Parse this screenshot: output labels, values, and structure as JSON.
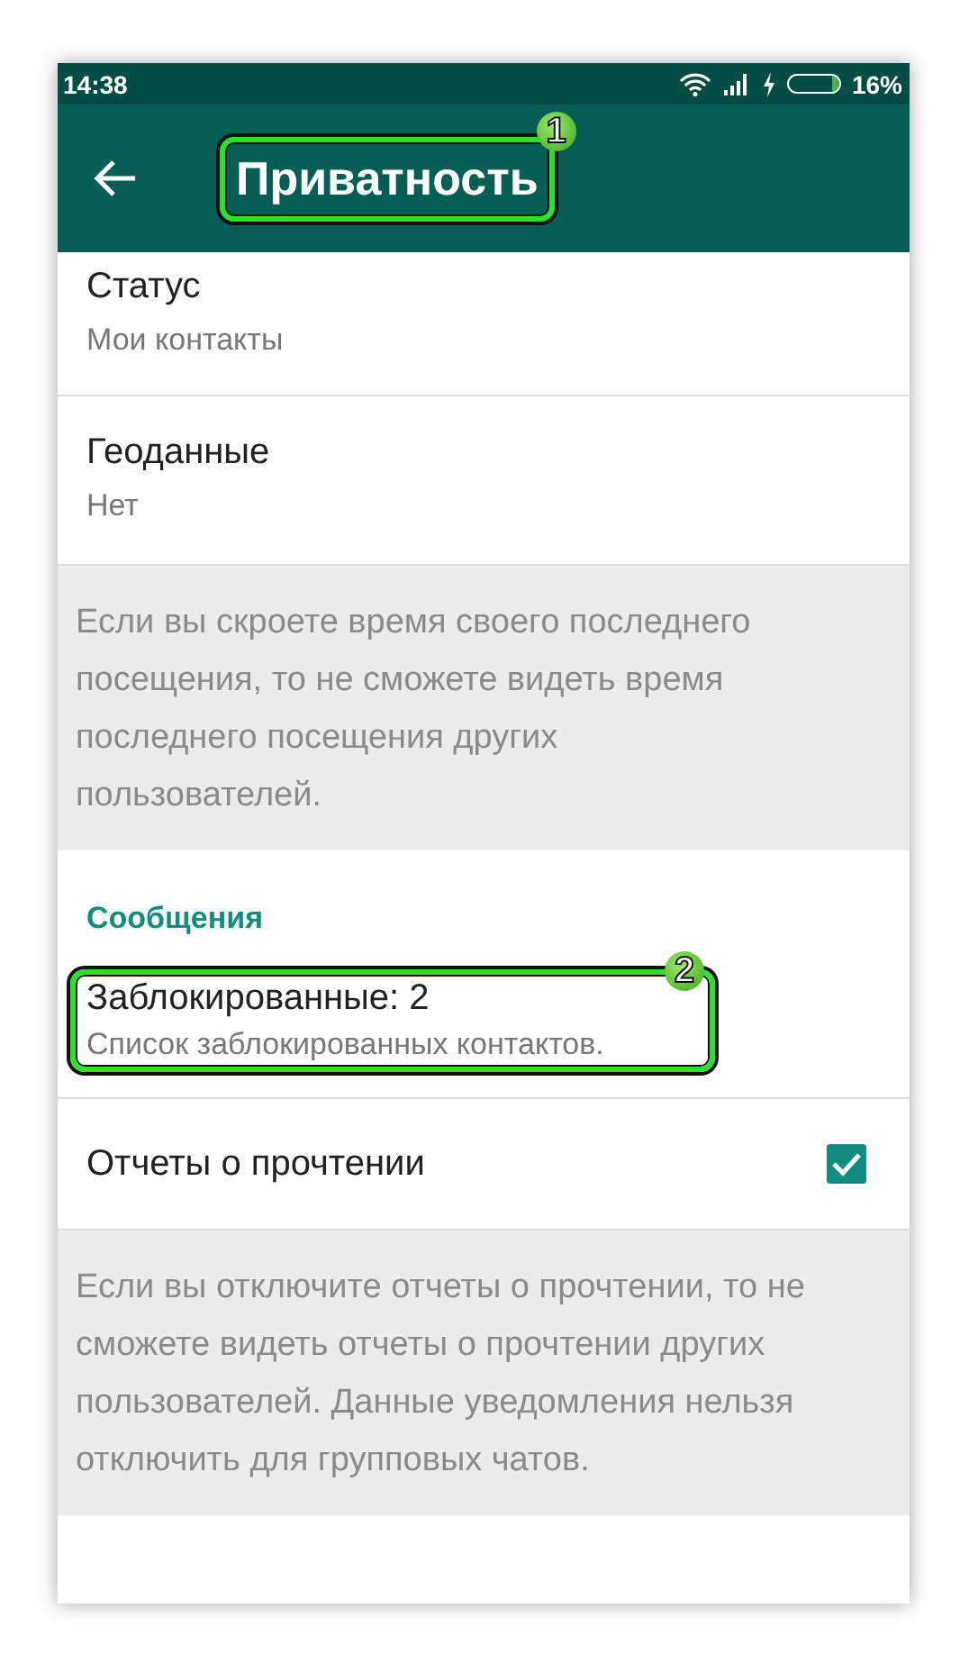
{
  "status_bar": {
    "time": "14:38",
    "battery": "16%"
  },
  "header": {
    "title": "Приватность",
    "callout": "1"
  },
  "items": [
    {
      "kind": "setting",
      "title": "Статус",
      "subtitle": "Мои контакты",
      "clipped": true
    },
    {
      "kind": "setting",
      "title": "Геоданные",
      "subtitle": "Нет"
    },
    {
      "kind": "note",
      "text": "Если вы скроете время своего последнего посещения, то не сможете видеть время последнего посещения других пользователей."
    },
    {
      "kind": "section",
      "title": "Сообщения"
    },
    {
      "kind": "setting",
      "title": "Заблокированные: 2",
      "subtitle": "Список заблокированных контактов.",
      "callout": "2"
    },
    {
      "kind": "toggle",
      "title": "Отчеты о прочтении",
      "checked": true
    },
    {
      "kind": "note",
      "text": "Если вы отключите отчеты о прочтении, то не сможете видеть отчеты о прочтении других пользователей. Данные уведомления нельзя отключить для групповых чатов."
    }
  ]
}
